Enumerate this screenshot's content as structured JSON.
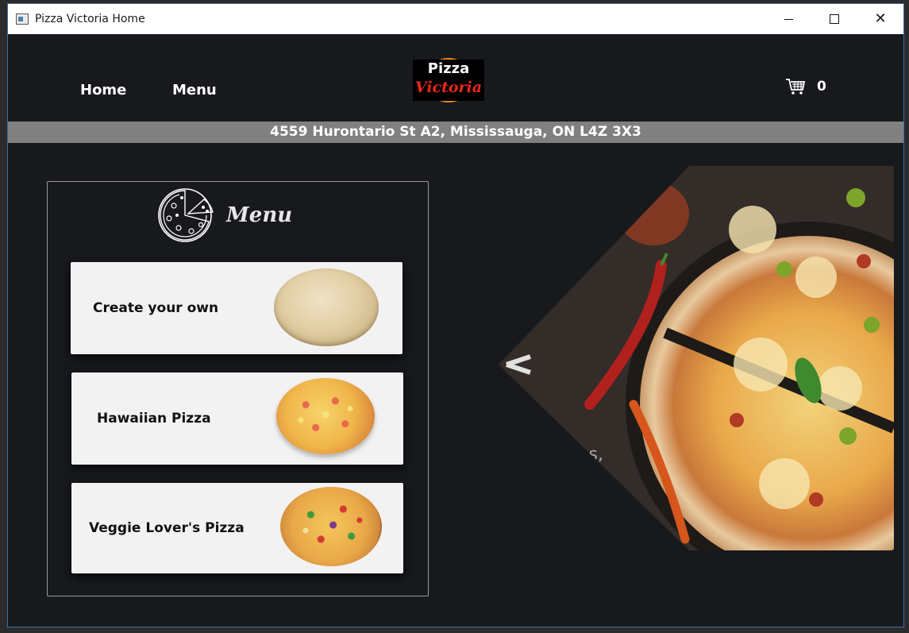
{
  "window": {
    "title": "Pizza Victoria Home",
    "controls": {
      "minimize": "minimize",
      "maximize": "maximize",
      "close": "close"
    }
  },
  "nav": {
    "home": "Home",
    "menu": "Menu"
  },
  "logo": {
    "line1": "Pizza",
    "line2": "Victoria"
  },
  "cart": {
    "icon": "shopping-cart-icon",
    "count": "0"
  },
  "address": "4559 Hurontario St A2, Mississauga, ON L4Z 3X3",
  "menu_panel": {
    "heading": "Menu",
    "heading_icon": "pizza-icon",
    "items": [
      {
        "label": "Create your own",
        "image": "pizza-dough-image"
      },
      {
        "label": "Hawaiian Pizza",
        "image": "hawaiian-pizza-image"
      },
      {
        "label": "Veggie Lover's Pizza",
        "image": "veggie-pizza-image"
      }
    ]
  },
  "hero": {
    "image": "pizza-hero-image"
  },
  "colors": {
    "background": "#17191d",
    "address_bar": "#808080",
    "card": "#f2f2f2",
    "logo_ring": "#f28c10",
    "logo_red": "#e8261c"
  }
}
